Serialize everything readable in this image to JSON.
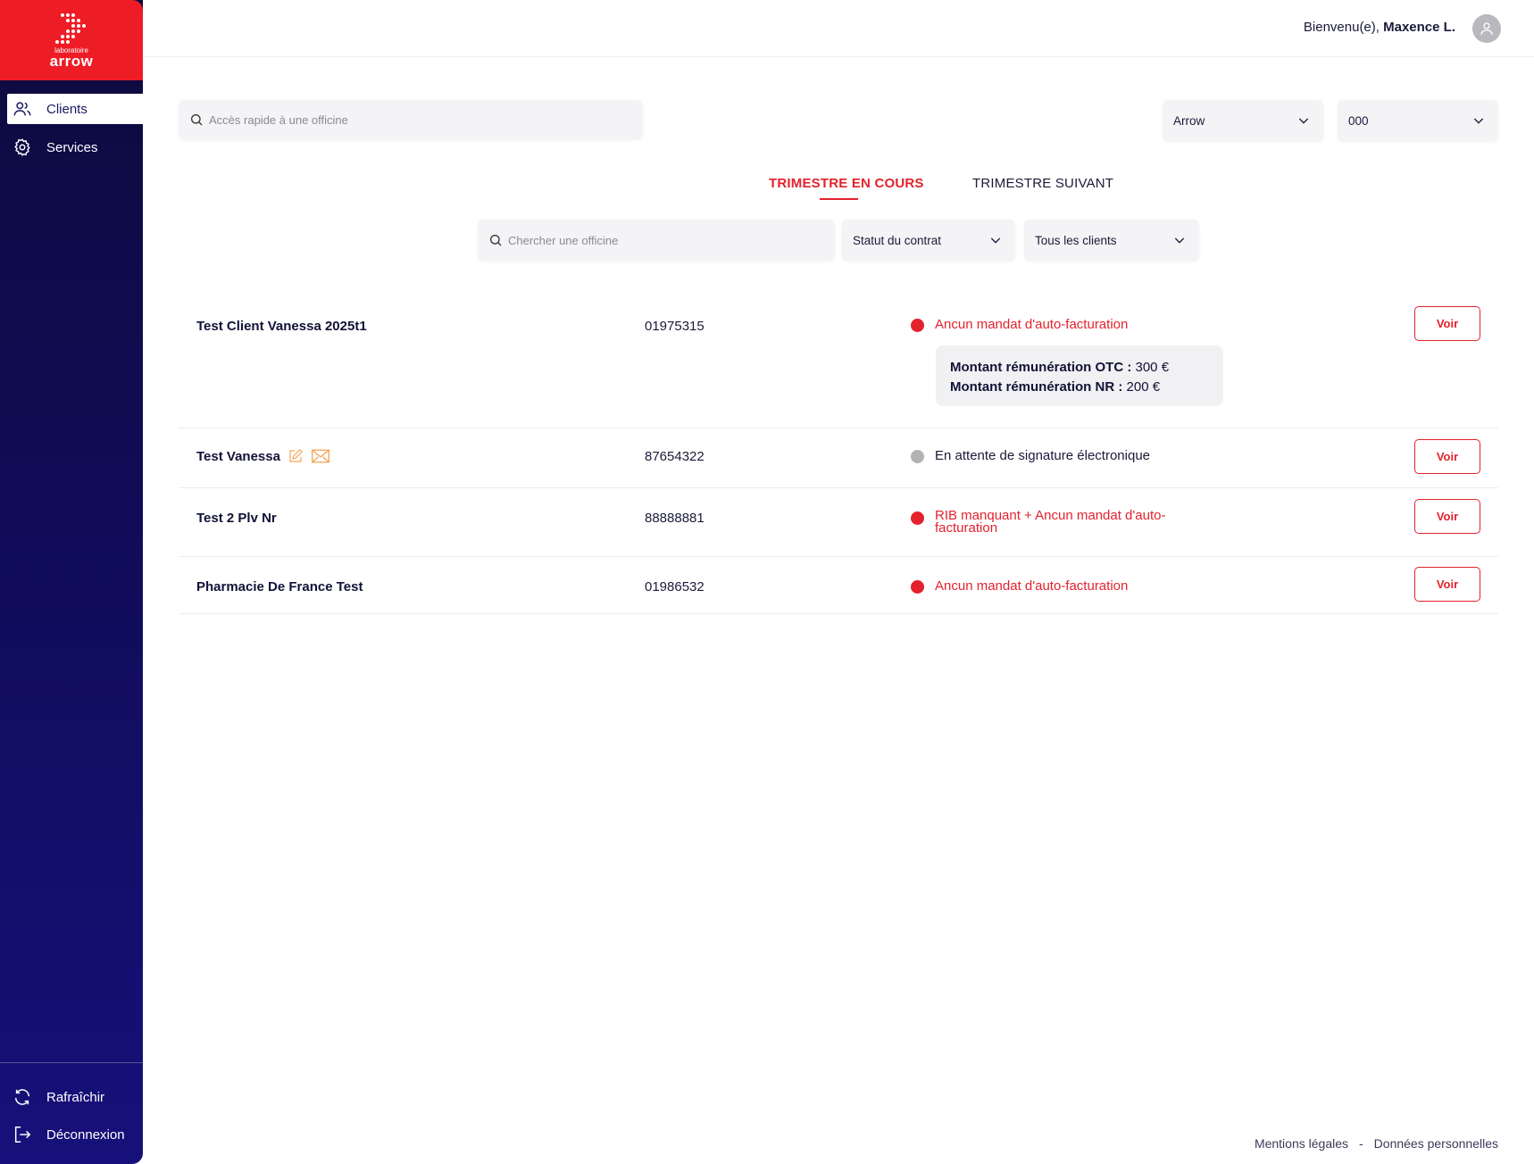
{
  "brand": {
    "small": "laboratoire",
    "name": "arrow",
    "color": "#ee1c25"
  },
  "sidebar": {
    "items": [
      {
        "label": "Clients",
        "icon": "users-icon",
        "active": true
      },
      {
        "label": "Services",
        "icon": "gear-icon",
        "active": false
      }
    ],
    "bottom": [
      {
        "label": "Rafraîchir",
        "icon": "refresh-icon"
      },
      {
        "label": "Déconnexion",
        "icon": "logout-icon"
      }
    ]
  },
  "header": {
    "welcome_prefix": "Bienvenu(e),",
    "user_name": "Maxence L."
  },
  "quick_search": {
    "placeholder": "Accès rapide à une officine"
  },
  "selects": {
    "lab": "Arrow",
    "code": "000"
  },
  "tabs": {
    "current": "TRIMESTRE EN COURS",
    "next": "TRIMESTRE SUIVANT"
  },
  "filters": {
    "search_placeholder": "Chercher une officine",
    "contract_status": "Statut du contrat",
    "clients": "Tous les clients"
  },
  "rows": [
    {
      "name": "Test Client Vanessa 2025t1",
      "code": "01975315",
      "status": "Ancun mandat d'auto-facturation",
      "status_color": "red",
      "amounts": {
        "otc_label": "Montant rémunération OTC :",
        "otc_value": " 300 €",
        "nr_label": "Montant rémunération NR :",
        "nr_value": " 200 €"
      },
      "action": "Voir"
    },
    {
      "name": "Test Vanessa",
      "code": "87654322",
      "status": "En attente de signature électronique",
      "status_color": "grey",
      "action": "Voir"
    },
    {
      "name": "Test 2 Plv Nr",
      "code": "88888881",
      "status": "RIB manquant + Ancun mandat d'auto-facturation",
      "status_color": "red",
      "action": "Voir"
    },
    {
      "name": "Pharmacie De France Test",
      "code": "01986532",
      "status": "Ancun mandat d'auto-facturation",
      "status_color": "red",
      "action": "Voir"
    }
  ],
  "footer": {
    "legal": "Mentions légales",
    "separator": "-",
    "privacy": "Données personnelles"
  },
  "colors": {
    "accent": "#e3222d",
    "sidebar": "#110d5e",
    "pending": "#b3b3b3"
  }
}
